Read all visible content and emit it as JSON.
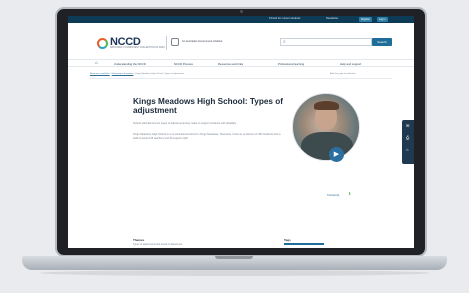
{
  "topbar": {
    "link1": "Printed for current students",
    "link2": "Newsletter",
    "register": "Register",
    "login": "Log in"
  },
  "header": {
    "logo_text": "NCCD",
    "logo_subtitle": "NATIONALLY CONSISTENT COLLECTION OF DATA",
    "gov_text": "An Australian Government initiative",
    "search_placeholder": "",
    "search_button": "Search"
  },
  "nav": {
    "items": [
      "Understanding the NCCD",
      "NCCD Process",
      "Resources and links",
      "Professional learning",
      "Help and support"
    ]
  },
  "breadcrumb": {
    "items": [
      "Resources and links",
      "Illustrations of practice",
      "Kings Meadows High School: Types of adjustment"
    ],
    "right": "Add this page to collection"
  },
  "main": {
    "title": "Kings Meadows High School: Types of adjustment",
    "paragraph1": "School staff discuss the types of adjustments they make to support students with disability.",
    "paragraph2": "Kings Meadows High School is a co-educational school in Kings Meadows, Tasmania. It has an enrolment of 450 students with a staff of around 45 teachers and 30 support staff.",
    "transcript_label": "Transcript"
  },
  "sections": {
    "left_title": "Themes",
    "left_sub": "Types of adjustments and levels of adjustment",
    "right_title": "Tags"
  },
  "colors": {
    "topbar": "#0d3a54",
    "accent": "#1f6d99",
    "logo_orange": "#e55f2a",
    "logo_green": "#56b847",
    "logo_blue": "#2aa4c6"
  }
}
